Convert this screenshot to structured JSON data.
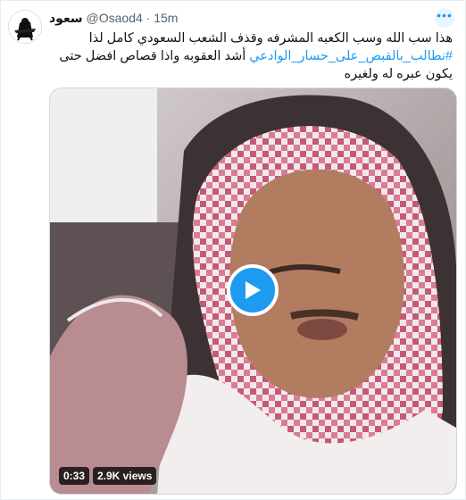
{
  "tweet": {
    "display_name": "سعود",
    "handle": "@Osaod4",
    "separator": "·",
    "time": "15m",
    "more_label": "•••",
    "line1": "هذا سب الله وسب الكعبه المشرفه وقذف الشعب السعودي كامل لذا",
    "hashtag": "#نطالب_بالقبض_على_حسار_الوادعي",
    "line2_rest": " أشد العقوبه واذا قصاص افضل حتى",
    "line3": "يكون عبره له ولغيره"
  },
  "media": {
    "duration": "0:33",
    "views": "2.9K views"
  },
  "colors": {
    "accent": "#1d9bf0",
    "text": "#0f1419",
    "muted": "#536471"
  }
}
